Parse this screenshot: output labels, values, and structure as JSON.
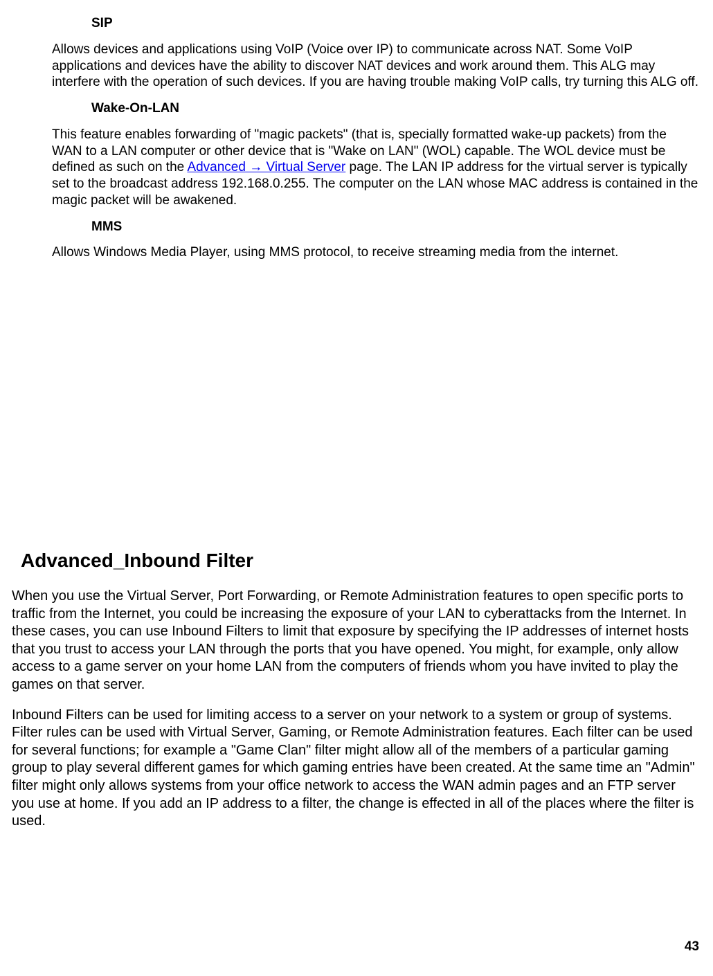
{
  "sip": {
    "title": "SIP",
    "desc": "Allows devices and applications using VoIP (Voice over IP) to communicate across NAT. Some VoIP applications and devices have the ability to discover NAT devices and work around them. This ALG may interfere with the operation of such devices. If you are having trouble making VoIP calls, try turning this ALG off."
  },
  "wol": {
    "title": "Wake-On-LAN",
    "desc_before": "This feature enables forwarding of \"magic packets\" (that is, specially formatted wake-up packets) from the WAN to a LAN computer or other device that is \"Wake on LAN\" (WOL) capable. The WOL device must be defined as such on the ",
    "link_text": "Advanced → Virtual Server",
    "desc_after": " page. The LAN IP address for the virtual server is typically set to the broadcast address 192.168.0.255. The computer on the LAN whose MAC address is contained in the magic packet will be awakened."
  },
  "mms": {
    "title": "MMS",
    "desc": "Allows Windows Media Player, using MMS protocol, to receive streaming media from the internet."
  },
  "section": {
    "title": "Advanced_Inbound Filter",
    "p1": "When you use the Virtual Server, Port Forwarding, or Remote Administration features to open specific ports to traffic from the Internet, you could be increasing the exposure of your LAN to cyberattacks from the Internet. In these cases, you can use Inbound Filters to limit that exposure by specifying the IP addresses of internet hosts that you trust to access your LAN through the ports that you have opened. You might, for example, only allow access to a game server on your home LAN from the computers of friends whom you have invited to play the games on that server.",
    "p2": "Inbound Filters can be used for limiting access to a server on your network to a system or group of systems. Filter rules can be used with Virtual Server, Gaming, or Remote Administration features. Each filter can be used for several functions; for example a \"Game Clan\" filter might allow all of the members of a particular gaming group to play several different games for which gaming entries have been created. At the same time an \"Admin\" filter might only allows systems from your office network to access the WAN admin pages and an FTP server you use at home. If you add an IP address to a filter, the change is effected in all of the places where the filter is used."
  },
  "page_number": "43"
}
